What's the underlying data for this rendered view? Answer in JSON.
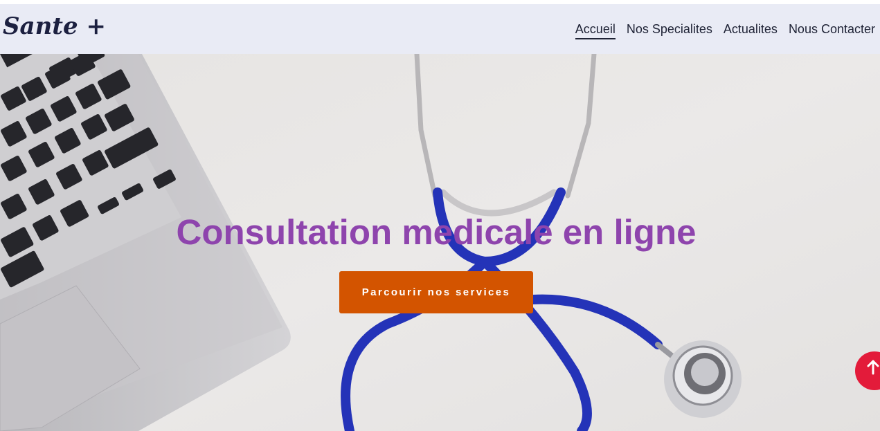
{
  "header": {
    "brand": "Sante +",
    "nav": [
      {
        "label": "Accueil",
        "active": true
      },
      {
        "label": "Nos Specialites",
        "active": false
      },
      {
        "label": "Actualites",
        "active": false
      },
      {
        "label": "Nous Contacter",
        "active": false
      }
    ]
  },
  "hero": {
    "title": "Consultation medicale en ligne",
    "button_label": "Parcourir nos services",
    "background_description_icon": "laptop-stethoscope-photo"
  },
  "scroll_top": {
    "icon": "arrow-up-icon"
  },
  "colors": {
    "navbar_bg": "#e9ebf5",
    "title": "#8e44ad",
    "button": "#d35400",
    "scroll_top": "#e31b3a"
  }
}
